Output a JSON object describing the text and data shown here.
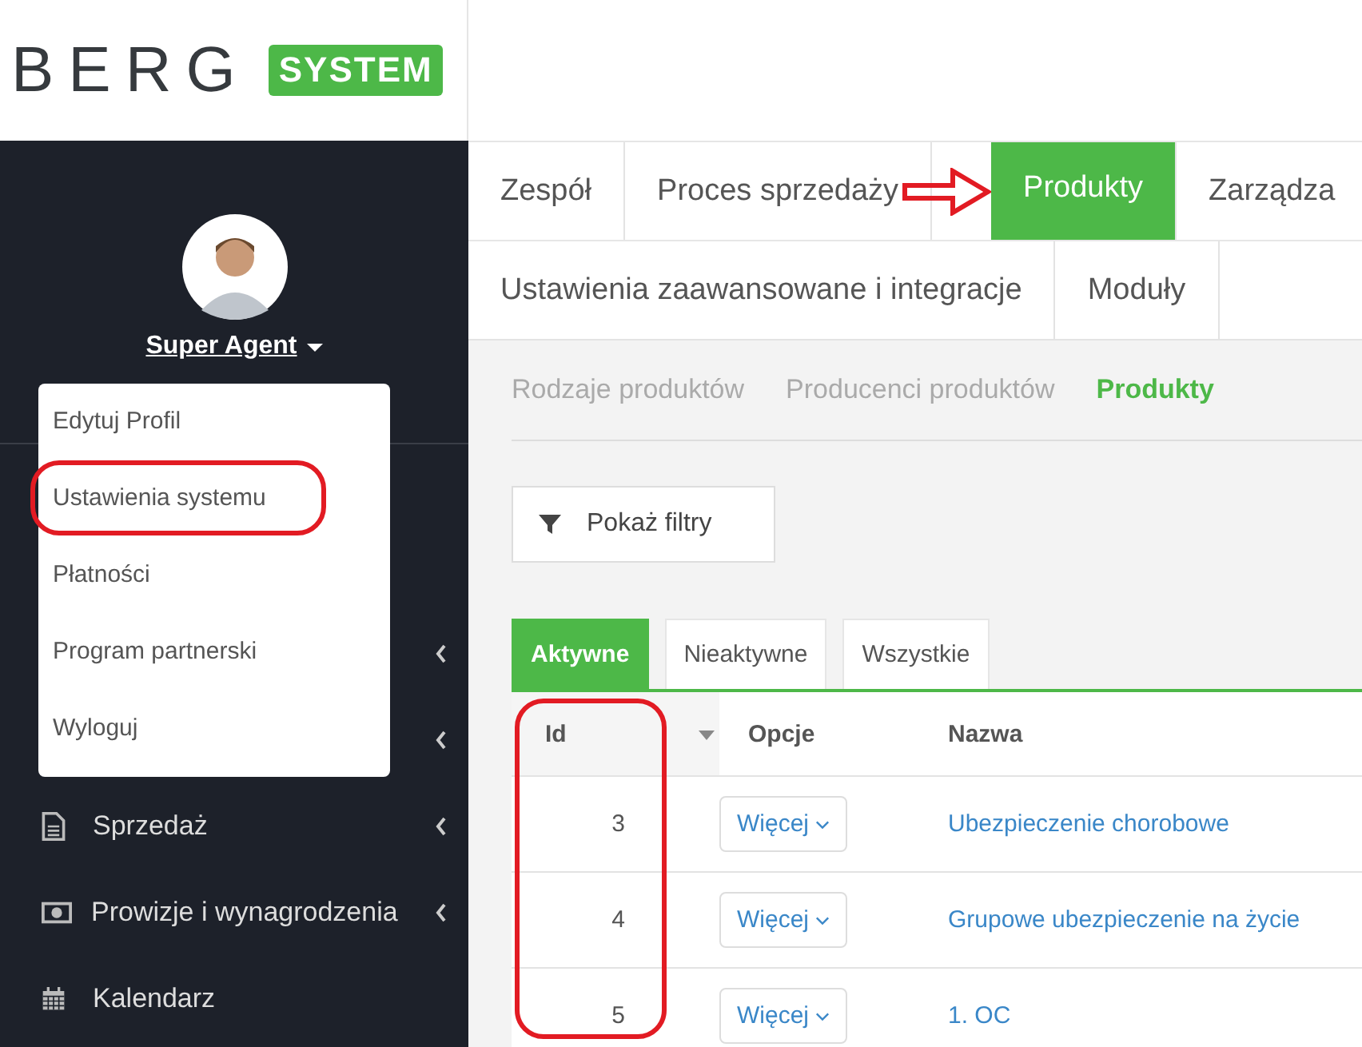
{
  "logo": {
    "wordmark": "BERG",
    "badge": "SYSTEM"
  },
  "user": {
    "name": "Super Agent",
    "menu_open": true
  },
  "user_menu": [
    {
      "label": "Edytuj Profil"
    },
    {
      "label": "Ustawienia systemu"
    },
    {
      "label": "Płatności"
    },
    {
      "label": "Program partnerski"
    },
    {
      "label": "Wyloguj"
    }
  ],
  "sidebar": {
    "items": [
      {
        "has_submenu": true
      },
      {
        "has_submenu": true
      },
      {
        "label": "Sprzedaż",
        "kind": "document",
        "has_submenu": true
      },
      {
        "label": "Prowizje i wynagrodzenia",
        "kind": "banknote",
        "has_submenu": true
      },
      {
        "label": "Kalendarz",
        "kind": "calendar",
        "has_submenu": false
      }
    ]
  },
  "tab_rows": [
    [
      {
        "label": "Zespół",
        "selected": false
      },
      {
        "label": "Proces sprzedaży",
        "selected": false
      },
      {
        "label": "Produkty",
        "selected": true
      },
      {
        "label": "Zarządza",
        "selected": false
      }
    ],
    [
      {
        "label": "Ustawienia zaawansowane i integracje",
        "selected": false
      },
      {
        "label": "Moduły",
        "selected": false
      }
    ]
  ],
  "subnav": [
    {
      "label": "Rodzaje produktów",
      "selected": false
    },
    {
      "label": "Producenci produktów",
      "selected": false
    },
    {
      "label": "Produkty",
      "selected": true
    }
  ],
  "filter_button": "Pokaż filtry",
  "status_tabs": [
    {
      "label": "Aktywne",
      "selected": true
    },
    {
      "label": "Nieaktywne",
      "selected": false
    },
    {
      "label": "Wszystkie",
      "selected": false
    }
  ],
  "table": {
    "columns": [
      {
        "label": "Id",
        "sorted": true
      },
      {
        "label": "Opcje",
        "sorted": false
      },
      {
        "label": "Nazwa",
        "sorted": false
      }
    ],
    "rows": [
      {
        "id": "3",
        "options": "Więcej",
        "name": "Ubezpieczenie chorobowe"
      },
      {
        "id": "4",
        "options": "Więcej",
        "name": "Grupowe ubezpieczenie na życie"
      },
      {
        "id": "5",
        "options": "Więcej",
        "name": "1. OC"
      }
    ]
  }
}
